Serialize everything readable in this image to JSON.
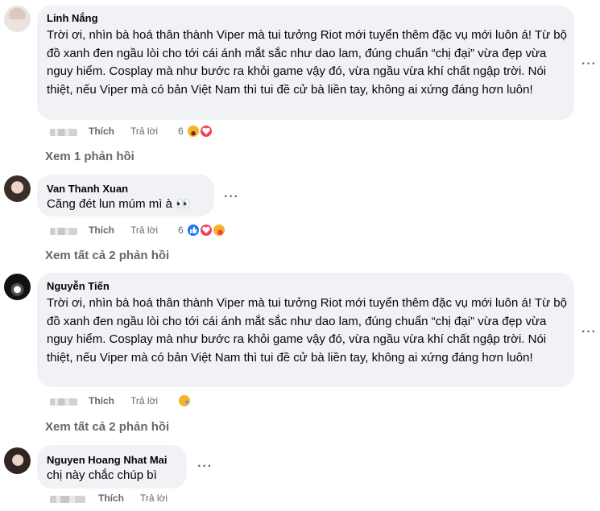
{
  "comments": [
    {
      "author": "Linh Nắng",
      "text": "Trời ơi, nhìn bà hoá thân thành Viper mà tui tưởng Riot mới tuyển thêm đặc vụ mới luôn á! Từ bộ đồ xanh đen ngầu lòi cho tới cái ánh mắt sắc như dao lam, đúng chuẩn “chị đại” vừa đẹp vừa nguy hiểm. Cosplay mà như bước ra khỏi game vậy đó, vừa ngầu vừa khí chất ngập trời. Nói thiệt, nếu Viper mà có bản Việt Nam thì tui đề cử bà liền tay, không ai xứng đáng hơn luôn!",
      "like_label": "Thích",
      "reply_label": "Trả lời",
      "reaction_count": "6",
      "reactions": [
        "laughing-face-icon",
        "heart-icon"
      ],
      "view_replies": "Xem 1 phản hồi"
    },
    {
      "author": "Van Thanh Xuan",
      "text": "Căng đét lun múm mì à 👀",
      "like_label": "Thích",
      "reply_label": "Trả lời",
      "reaction_count": "6",
      "reactions": [
        "like-icon",
        "heart-icon",
        "care-face-icon"
      ],
      "view_replies": "Xem tất cả 2 phản hồi"
    },
    {
      "author": "Nguyễn Tiến",
      "text": "Trời ơi, nhìn bà hoá thân thành Viper mà tui tưởng Riot mới tuyển thêm đặc vụ mới luôn á! Từ bộ đồ xanh đen ngầu lòi cho tới cái ánh mắt sắc như dao lam, đúng chuẩn “chị đại” vừa đẹp vừa nguy hiểm. Cosplay mà như bước ra khỏi game vậy đó, vừa ngầu vừa khí chất ngập trời. Nói thiệt, nếu Viper mà có bản Việt Nam thì tui đề cử bà liền tay, không ai xứng đáng hơn luôn!",
      "like_label": "Thích",
      "reply_label": "Trả lời",
      "reaction_count": "",
      "reactions": [
        "sad-face-icon"
      ],
      "view_replies": "Xem tất cả 2 phản hồi"
    },
    {
      "author": "Nguyen Hoang Nhat Mai",
      "text": "chị này chắc chúp bì",
      "like_label": "Thích",
      "reply_label": "Trả lời",
      "reaction_count": "",
      "reactions": [],
      "view_replies": ""
    }
  ],
  "more_glyph": "···",
  "colors": {
    "bubble": "#f0f2f5",
    "secondary_text": "#65676b",
    "like_blue": "#1877f2",
    "heart_red": "#f33e58",
    "emoji_yellow": "#f7b125"
  }
}
